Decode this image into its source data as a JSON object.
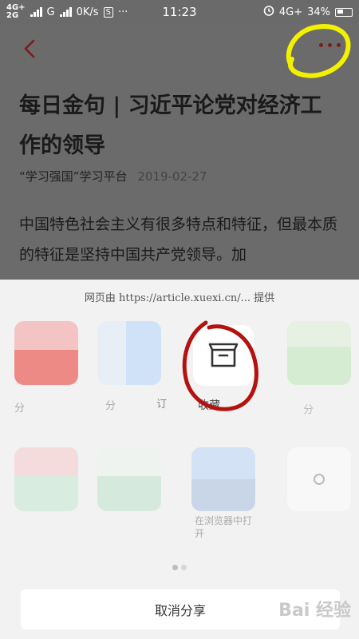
{
  "status_bar": {
    "net1": "4G+",
    "net2": "2G",
    "carrier_mark": "G",
    "speed": "0K/s",
    "s_badge": "S",
    "overflow": "···",
    "time": "11:23",
    "right_net": "4G+",
    "battery": "34%"
  },
  "article": {
    "title": "每日金句 | 习近平论党对经济工作的领导",
    "source": "“学习强国”学习平台",
    "date": "2019-02-27",
    "body": "中国特色社会主义有很多特点和特征，但最本质的特征是坚持中国共产党领导。加"
  },
  "share_sheet": {
    "provider": "网页由 https://article.xuexi.cn/... 提供",
    "favorite_label": "收藏",
    "blurred_labels": [
      "分",
      "分",
      "订",
      "分",
      "在浏览器中打开"
    ],
    "cancel_label": "取消分享",
    "page_count": 2
  },
  "watermark": "Bai 经验"
}
